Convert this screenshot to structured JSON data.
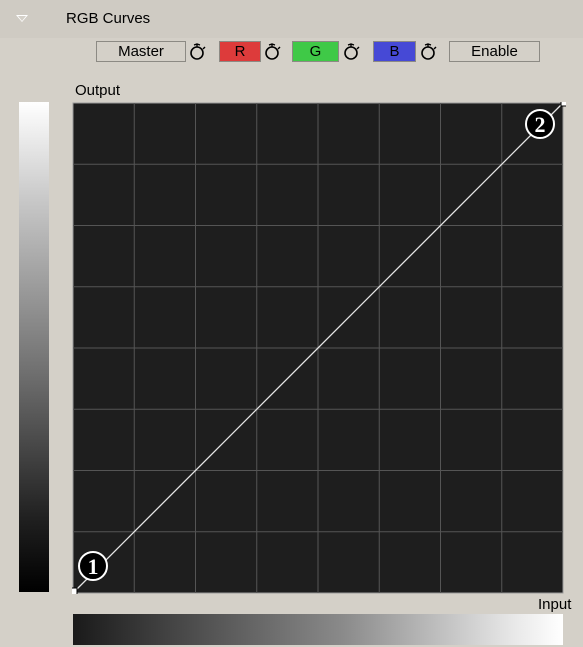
{
  "panel": {
    "title": "RGB Curves"
  },
  "toolbar": {
    "master_label": "Master",
    "r_label": "R",
    "g_label": "G",
    "b_label": "B",
    "enable_label": "Enable"
  },
  "graph": {
    "output_label": "Output",
    "input_label": "Input",
    "point1_badge": "1",
    "point2_badge": "2"
  },
  "colors": {
    "r": "#dd3b3b",
    "g": "#3fc947",
    "b": "#4649d6",
    "graph_bg": "#1e1e1e",
    "grid": "#555555",
    "curve": "#e6e6e6"
  },
  "icons": {
    "collapse": "triangle-down-icon",
    "reset": "reset-hand-icon"
  }
}
